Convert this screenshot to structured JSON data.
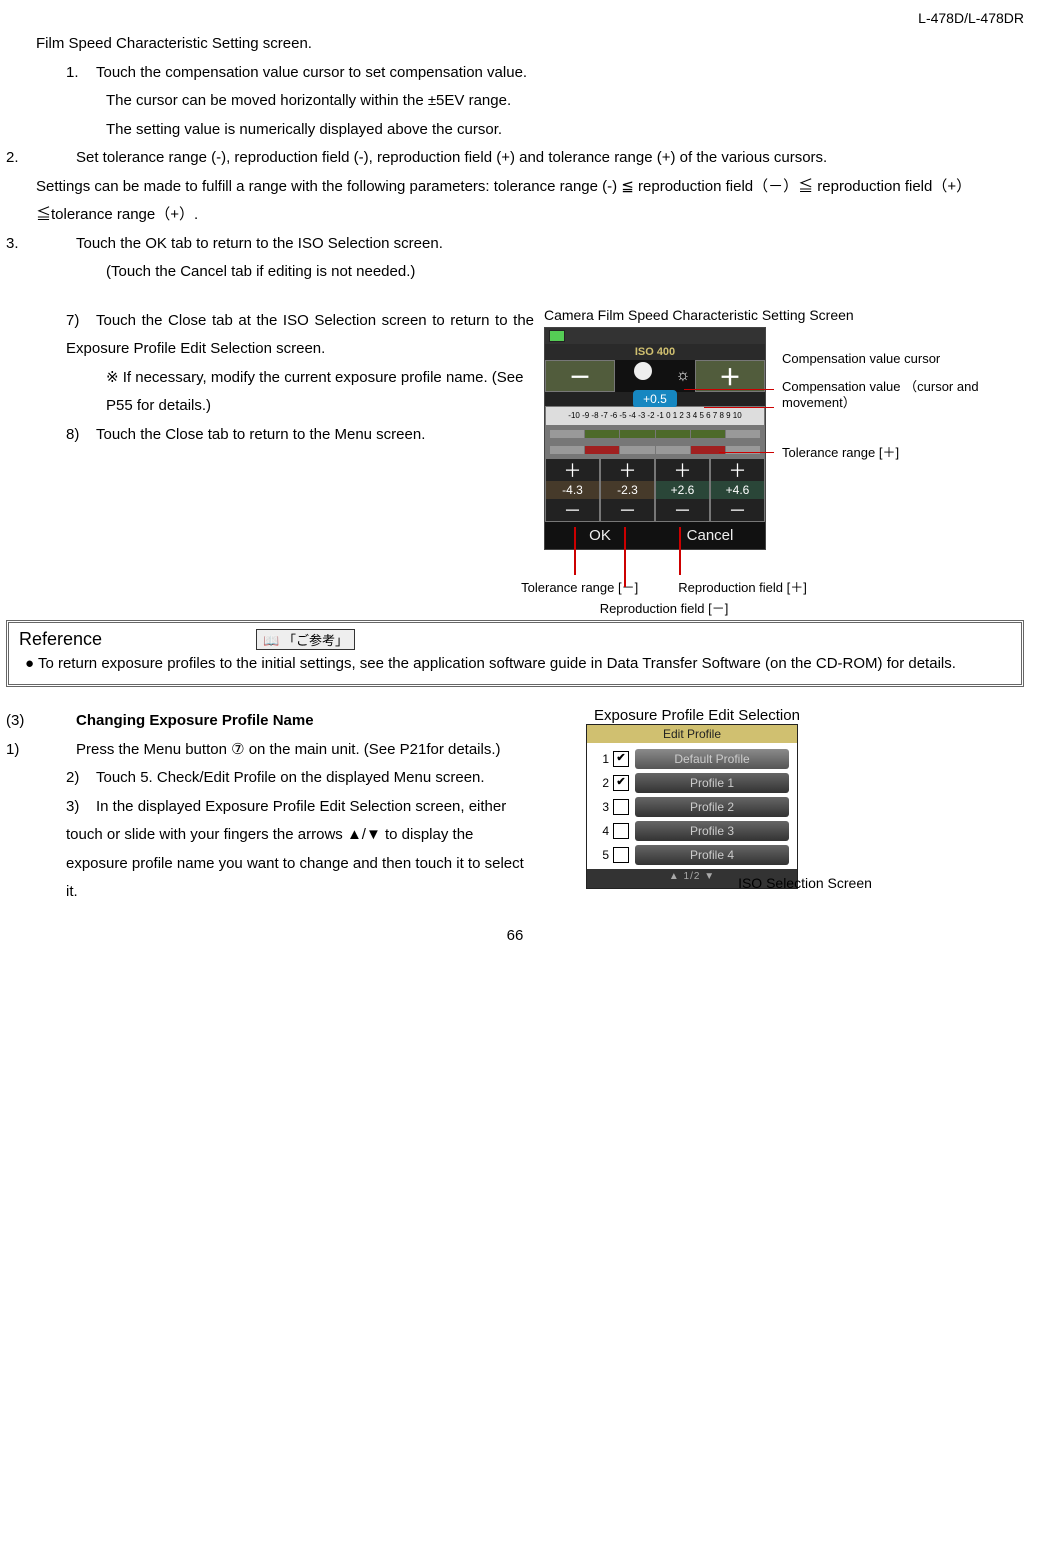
{
  "header_model": "L-478D/L-478DR",
  "top_line": "Film Speed Characteristic Setting screen.",
  "step1_num": "1.",
  "step1_a": "Touch the compensation value cursor to set compensation value.",
  "step1_b": "The cursor can be moved horizontally within the ±5EV range.",
  "step1_c": "The setting value is numerically displayed above the cursor.",
  "step2_num": "2.",
  "step2_a": "Set tolerance range (-), reproduction field (-), reproduction field (+) and tolerance range (+) of the various cursors.",
  "step2_b": "Settings can be made to fulfill a range with the following parameters: tolerance range (-) ≦ reproduction field（－）≦ reproduction field（+）≦tolerance range（+）.",
  "step3_num": "3.",
  "step3_a": "Touch the OK tab to return to the ISO Selection screen.",
  "step3_b": "(Touch the Cancel tab if editing is not needed.)",
  "step7_num": "7)",
  "step7_a": "Touch the Close tab at the ISO Selection screen to return to the Exposure Profile Edit Selection screen.",
  "step7_b": "※ If necessary, modify the current exposure profile name. (See P55 for details.)",
  "step8_num": "8)",
  "step8_a": "Touch the Close tab to return to the Menu screen.",
  "screen_title": "Camera Film Speed Characteristic Setting Screen",
  "iso_label": "ISO 400",
  "comp_val": "+0.5",
  "scale_text": "-10 -9 -8 -7 -6 -5 -4 -3 -2 -1 0 1 2 3 4 5 6 7 8 9 10",
  "q_vals": [
    "-4.3",
    "-2.3",
    "+2.6",
    "+4.6"
  ],
  "ok_label": "OK",
  "cancel_label": "Cancel",
  "ann_comp_cursor": "Compensation value cursor",
  "ann_comp_value": "Compensation value （cursor and movement）",
  "ann_tol_plus": "Tolerance range [＋]",
  "ann_tol_minus": "Tolerance range [－]",
  "ann_rep_minus": "Reproduction field [－]",
  "ann_rep_plus": "Reproduction field [＋]",
  "ref_title": "Reference",
  "gosanko": "「ご参考」",
  "ref_text": "● To return exposure profiles to the initial settings, see the application software guide in Data Transfer Software (on the CD-ROM) for details.",
  "sec3_num": "(3)",
  "sec3_title": "Changing Exposure Profile Name",
  "s3_1_num": "1)",
  "s3_1": "Press the Menu button ⑦ on the main unit. (See P21for details.)",
  "s3_2_num": "2)",
  "s3_2": "Touch 5. Check/Edit Profile on the displayed Menu screen.",
  "s3_3_num": "3)",
  "s3_3": "In the displayed Exposure Profile Edit Selection screen, either touch or slide with your fingers the arrows ▲/▼ to display the exposure profile name you want to change and then touch it to select it.",
  "edit_title": "Exposure Profile Edit Selection",
  "edit_hdr": "Edit Profile",
  "profiles": [
    {
      "n": "1",
      "chk": "✔",
      "label": "Default Profile",
      "sel": true
    },
    {
      "n": "2",
      "chk": "✔",
      "label": "Profile 1",
      "sel": false
    },
    {
      "n": "3",
      "chk": "",
      "label": "Profile 2",
      "sel": false
    },
    {
      "n": "4",
      "chk": "",
      "label": "Profile 3",
      "sel": false
    },
    {
      "n": "5",
      "chk": "",
      "label": "Profile 4",
      "sel": false
    }
  ],
  "edit_foot": "▲ 1/2 ▼",
  "iso_caption": "ISO Selection Screen",
  "page_num": "66",
  "plus": "＋",
  "minus": "－",
  "sun_icon": "☼"
}
